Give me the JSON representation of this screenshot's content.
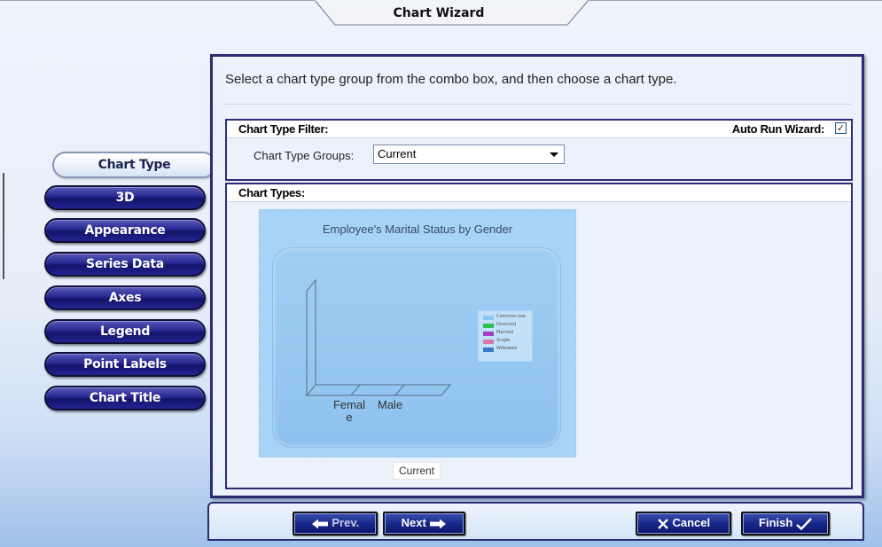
{
  "window": {
    "title": "Chart Wizard"
  },
  "nav": {
    "items": [
      {
        "label": "Chart Type",
        "active": true
      },
      {
        "label": "3D"
      },
      {
        "label": "Appearance"
      },
      {
        "label": "Series Data"
      },
      {
        "label": "Axes"
      },
      {
        "label": "Legend"
      },
      {
        "label": "Point Labels"
      },
      {
        "label": "Chart Title"
      }
    ]
  },
  "main": {
    "instructions": "Select a chart type group from the combo box, and then choose a chart type.",
    "filter": {
      "title": "Chart Type Filter:",
      "auto_run_label": "Auto Run Wizard:",
      "auto_run_checked": true,
      "groups_label": "Chart Type Groups:",
      "groups_value": "Current"
    },
    "types": {
      "title": "Chart Types:",
      "thumbnail": {
        "chart_title": "Employee's Marital Status by Gender",
        "x_categories": [
          "Femal\ne",
          "Male"
        ],
        "legend": [
          "Common-law",
          "Divorced",
          "Married",
          "Single",
          "Widowed"
        ],
        "legend_colors": [
          "#8ec8f0",
          "#2fbf55",
          "#a040c0",
          "#d47aa8",
          "#3a78c8"
        ],
        "caption": "Current"
      }
    }
  },
  "footer": {
    "prev_label": "Prev.",
    "next_label": "Next",
    "cancel_label": "Cancel",
    "finish_label": "Finish"
  }
}
